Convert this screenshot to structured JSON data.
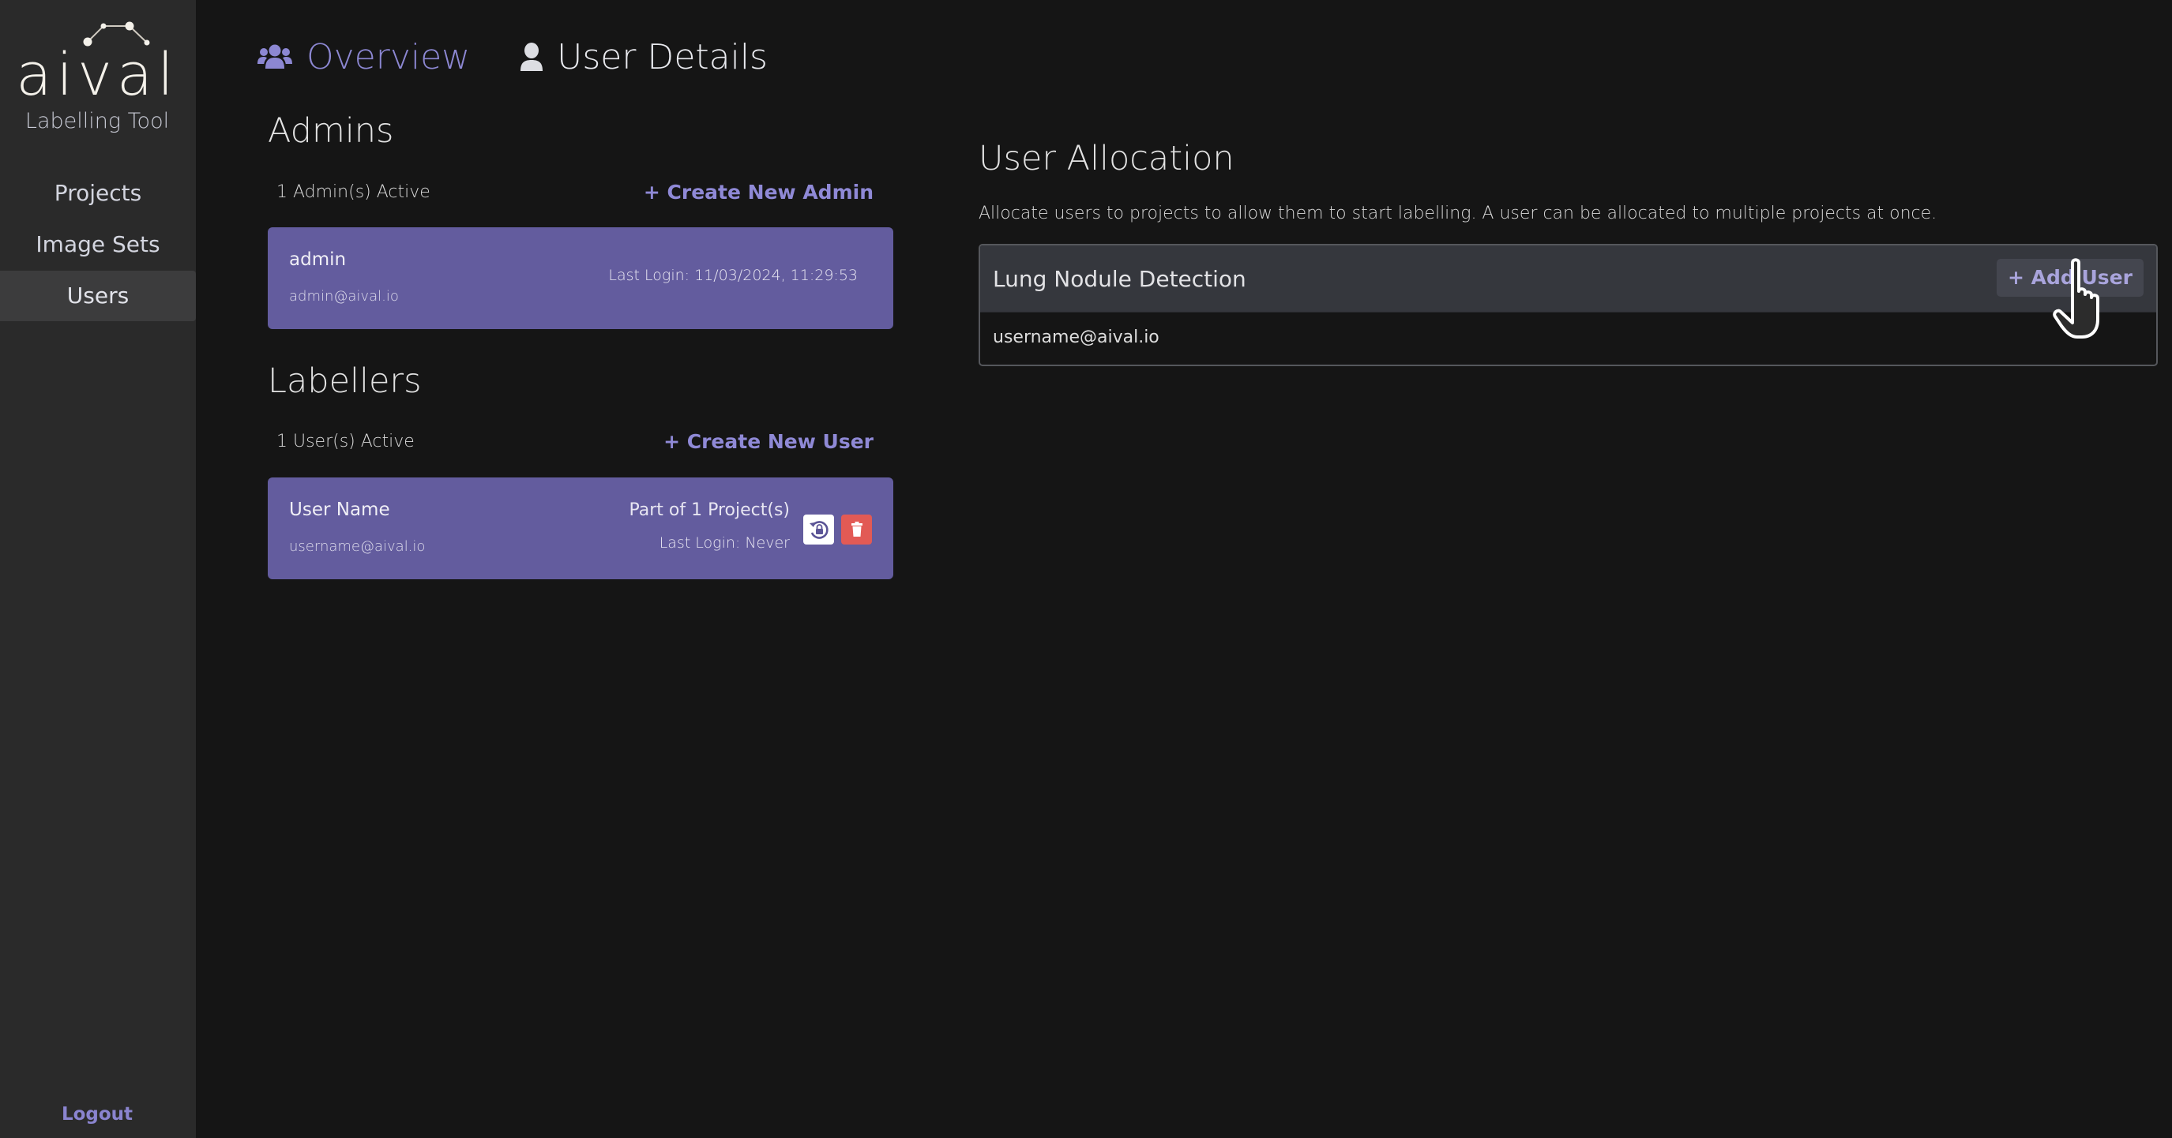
{
  "app": {
    "logo_text": "aival",
    "subtitle": "Labelling Tool"
  },
  "sidebar": {
    "items": [
      {
        "label": "Projects",
        "active": false
      },
      {
        "label": "Image Sets",
        "active": false
      },
      {
        "label": "Users",
        "active": true
      }
    ],
    "logout_label": "Logout"
  },
  "tabs": [
    {
      "label": "Overview",
      "icon": "users-icon",
      "active": true
    },
    {
      "label": "User Details",
      "icon": "user-icon",
      "active": false
    }
  ],
  "admins": {
    "title": "Admins",
    "count_text": "1 Admin(s) Active",
    "create_label": "+ Create New Admin",
    "items": [
      {
        "name": "admin",
        "email": "admin@aival.io",
        "last_login": "Last Login: 11/03/2024, 11:29:53"
      }
    ]
  },
  "labellers": {
    "title": "Labellers",
    "count_text": "1 User(s) Active",
    "create_label": "+ Create New User",
    "items": [
      {
        "name": "User Name",
        "email": "username@aival.io",
        "projects": "Part of 1 Project(s)",
        "last_login": "Last Login: Never",
        "actions": [
          "reset-password-icon",
          "trash-icon"
        ]
      }
    ]
  },
  "allocation": {
    "title": "User Allocation",
    "description": "Allocate users to projects to allow them to start labelling. A user can be allocated to multiple projects at once.",
    "projects": [
      {
        "name": "Lung Nodule Detection",
        "add_label": "+ Add User",
        "users": [
          "username@aival.io"
        ]
      }
    ]
  },
  "colors": {
    "accent": "#8c87d2",
    "card": "#635c9e",
    "danger": "#e25a55",
    "background": "#151515",
    "sidebar": "#2a2a2a"
  }
}
